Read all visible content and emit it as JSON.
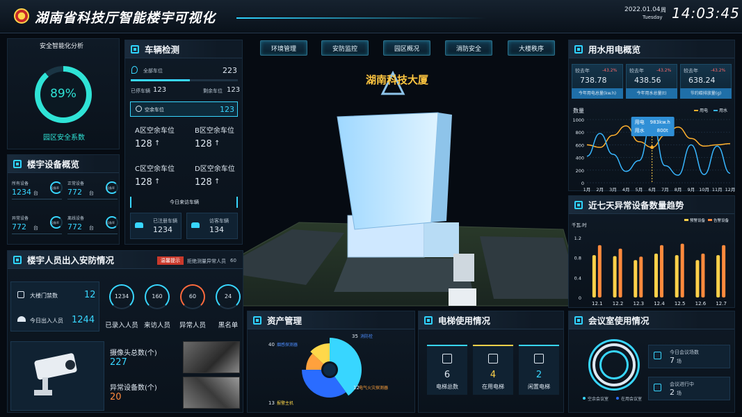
{
  "header": {
    "title": "湖南省科技厅智能楼宇可视化",
    "date": "2022.01.04",
    "weekday_cn": "周",
    "weekday_en": "Tuesday",
    "time": "14:03:45",
    "emblem_icon": "national-emblem-icon"
  },
  "nav": [
    {
      "label": "环境管理"
    },
    {
      "label": "安防监控"
    },
    {
      "label": "园区概况"
    },
    {
      "label": "消防安全"
    },
    {
      "label": "大楼秩序"
    }
  ],
  "building": {
    "label": "湖南科技大厦"
  },
  "security": {
    "title": "安全智能化分析",
    "percent": "89%",
    "percent_value": 0.89,
    "caption": "园区安全系数"
  },
  "devices": {
    "title": "楼宇设备概览",
    "items": [
      {
        "label": "所有设备",
        "value": "1234",
        "unit": "台",
        "ring_label": "设备率"
      },
      {
        "label": "正常设备",
        "value": "772",
        "unit": "台",
        "ring_label": "设备率"
      },
      {
        "label": "异常设备",
        "value": "772",
        "unit": "台",
        "ring_label": "设备率"
      },
      {
        "label": "离线设备",
        "value": "772",
        "unit": "台",
        "ring_label": "设备率"
      }
    ]
  },
  "vehicles": {
    "title": "车辆检测",
    "total_label": "全部车位",
    "total": "223",
    "parked_label": "已停车辆",
    "parked": "123",
    "left_label": "剩余车位",
    "left": "123",
    "occupancy": 0.55,
    "empty_label": "空余车位",
    "empty": "123",
    "zones": [
      {
        "label": "A区空余车位",
        "value": "128",
        "arrow": "↑"
      },
      {
        "label": "B区空余车位",
        "value": "128",
        "arrow": "↑"
      },
      {
        "label": "C区空余车位",
        "value": "128",
        "arrow": "↑"
      },
      {
        "label": "D区空余车位",
        "value": "128",
        "arrow": "↑"
      }
    ],
    "visitors_title": "今日来访车辆",
    "registered_label": "已注册车辆",
    "registered": "1234",
    "guest_label": "访客车辆",
    "guest": "134"
  },
  "people": {
    "title": "楼宇人员出入安防情况",
    "warn_tag": "温馨提示",
    "warn_text": "拒绝测量异常人员",
    "warn_count": "60",
    "gate_label": "大楼门禁数",
    "gate": "12",
    "today_label": "今日出入人员",
    "today": "1244",
    "circles": [
      {
        "value": "1234",
        "label": "已录入人员",
        "color": "#38d6ff"
      },
      {
        "value": "160",
        "label": "来访人员",
        "color": "#38d6ff"
      },
      {
        "value": "60",
        "label": "异常人员",
        "color": "#ff6a3d"
      },
      {
        "value": "24",
        "label": "黑名单",
        "color": "#38d6ff"
      }
    ],
    "camera_label": "摄像头总数(个)",
    "camera": "227",
    "abnormal_label": "异常设备数(个)",
    "abnormal": "20"
  },
  "utility": {
    "title": "用水用电概览",
    "cards": [
      {
        "cmp": "较去年",
        "pct": "-43.2%",
        "value": "738.78",
        "label": "今年用电总量(kw.h)"
      },
      {
        "cmp": "较去年",
        "pct": "-43.2%",
        "value": "438.56",
        "label": "今年用水总量(t)"
      },
      {
        "cmp": "较去年",
        "pct": "-43.2%",
        "value": "638.24",
        "label": "节约碳排放量(g)"
      }
    ],
    "tooltip": {
      "elec_label": "用电",
      "elec": "983kw.h",
      "water_label": "用水",
      "water": "800t"
    }
  },
  "anomaly": {
    "title": "近七天异常设备数量趋势"
  },
  "assets": {
    "title": "资产管理",
    "slices": [
      {
        "value": "40",
        "label": "烟感探测器"
      },
      {
        "value": "35",
        "label": "消防栓"
      },
      {
        "value": "12",
        "label": "电气火灾探测器"
      },
      {
        "value": "13",
        "label": "报警主机"
      }
    ]
  },
  "elevator": {
    "title": "电梯使用情况",
    "items": [
      {
        "value": "6",
        "label": "电梯总数"
      },
      {
        "value": "4",
        "label": "在用电梯"
      },
      {
        "value": "2",
        "label": "闲置电梯"
      }
    ]
  },
  "meeting": {
    "title": "会议室使用情况",
    "today_label": "今日会议场数",
    "today": "7",
    "today_unit": "场",
    "ongoing_label": "会议进行中",
    "ongoing": "2",
    "ongoing_unit": "场",
    "legend_free": "空余会议室",
    "legend_used": "在用会议室"
  },
  "colors": {
    "accent": "#38d6ff",
    "orange": "#ff8a3d",
    "yellow": "#ffd14a",
    "bg": "#060b12"
  },
  "chart_data": [
    {
      "type": "line",
      "title": "",
      "ylabel": "数量",
      "categories": [
        "1月",
        "2月",
        "3月",
        "4月",
        "5月",
        "6月",
        "7月",
        "8月",
        "9月",
        "10月",
        "11月",
        "12月"
      ],
      "ylim": [
        0,
        1000
      ],
      "yticks": [
        "0",
        "200",
        "400",
        "600",
        "800",
        "1000"
      ],
      "legend_position": "top-right",
      "series": [
        {
          "name": "用电",
          "color": "#ffb02e",
          "values": [
            600,
            560,
            750,
            900,
            650,
            560,
            750,
            880,
            700,
            580,
            600,
            620
          ]
        },
        {
          "name": "用水",
          "color": "#38b6ff",
          "values": [
            420,
            780,
            450,
            180,
            350,
            980,
            270,
            120,
            600,
            130,
            580,
            150
          ]
        }
      ]
    },
    {
      "type": "bar",
      "title": "",
      "ylabel": "千瓦.时",
      "categories": [
        "12.1",
        "12.2",
        "12.3",
        "12.4",
        "12.5",
        "12.6",
        "12.7"
      ],
      "ylim": [
        0,
        1.2
      ],
      "yticks": [
        "0",
        "0.4",
        "0.8",
        "1.2"
      ],
      "legend_position": "top-right",
      "series": [
        {
          "name": "预警设备",
          "color": "#ffd14a",
          "values": [
            0.85,
            0.83,
            0.75,
            0.88,
            0.85,
            0.75,
            0.85
          ]
        },
        {
          "name": "告警设备",
          "color": "#ff8a3d",
          "values": [
            1.05,
            0.98,
            0.82,
            1.05,
            1.08,
            0.88,
            1.05
          ]
        }
      ]
    },
    {
      "type": "pie",
      "title": "",
      "categories": [
        "烟感探测器",
        "消防栓",
        "电气火灾探测器",
        "报警主机"
      ],
      "values": [
        40,
        35,
        12,
        13
      ],
      "colors": [
        "#38d6ff",
        "#2a6cff",
        "#ffa13d",
        "#ffd84a"
      ]
    }
  ]
}
